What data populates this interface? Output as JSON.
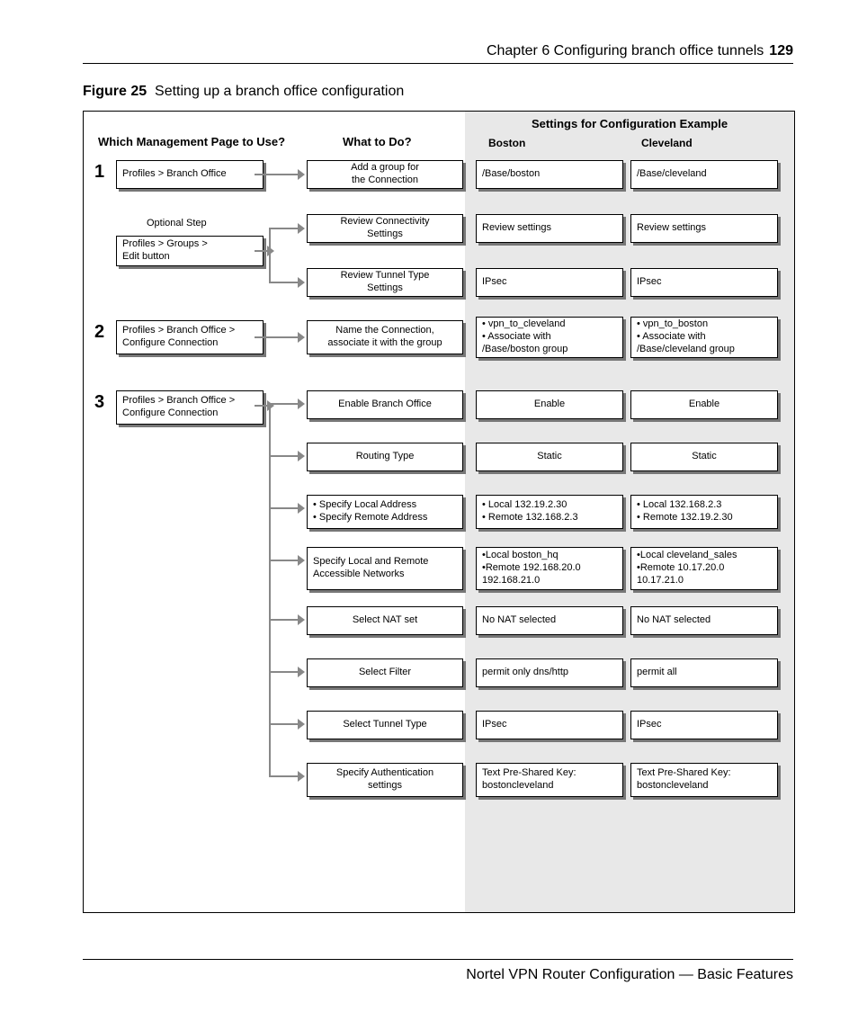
{
  "header": {
    "chapter": "Chapter 6  Configuring branch office tunnels",
    "pageNum": "129"
  },
  "figTitle": {
    "label": "Figure 25",
    "caption": "Setting up a branch office configuration"
  },
  "cols": {
    "mgmt": "Which Management Page to Use?",
    "what": "What to Do?",
    "settings": "Settings for Configuration Example",
    "boston": "Boston",
    "cleveland": "Cleveland"
  },
  "optStep": "Optional Step",
  "step1": {
    "num": "1",
    "page": "Profiles > Branch Office",
    "optPage": "Profiles > Groups >\nEdit button",
    "rows": [
      {
        "what": "Add a group for\nthe Connection",
        "b": "/Base/boston",
        "c": "/Base/cleveland"
      },
      {
        "what": "Review Connectivity\nSettings",
        "b": "Review settings",
        "c": "Review settings"
      },
      {
        "what": "Review Tunnel Type\nSettings",
        "b": "IPsec",
        "c": "IPsec"
      }
    ]
  },
  "step2": {
    "num": "2",
    "page": "Profiles > Branch Office >\nConfigure Connection",
    "rows": [
      {
        "what": "Name the Connection,\nassociate it with the group",
        "b": "• vpn_to_cleveland\n• Associate with\n  /Base/boston group",
        "c": "• vpn_to_boston\n• Associate with\n  /Base/cleveland group"
      }
    ]
  },
  "step3": {
    "num": "3",
    "page": "Profiles > Branch Office >\nConfigure Connection",
    "rows": [
      {
        "what": "Enable Branch Office",
        "b": "Enable",
        "c": "Enable"
      },
      {
        "what": "Routing Type",
        "b": "Static",
        "c": "Static"
      },
      {
        "what": "• Specify Local Address\n• Specify Remote Address",
        "b": "• Local 132.19.2.30\n• Remote 132.168.2.3",
        "c": "• Local 132.168.2.3\n• Remote 132.19.2.30"
      },
      {
        "what": "Specify Local and Remote\nAccessible Networks",
        "b": "•Local boston_hq\n•Remote 192.168.20.0\n            192.168.21.0",
        "c": "•Local cleveland_sales\n•Remote 10.17.20.0\n            10.17.21.0"
      },
      {
        "what": "Select NAT set",
        "b": "No NAT selected",
        "c": "No NAT selected"
      },
      {
        "what": "Select Filter",
        "b": "permit only dns/http",
        "c": "permit all"
      },
      {
        "what": "Select Tunnel Type",
        "b": "IPsec",
        "c": "IPsec"
      },
      {
        "what": "Specify Authentication\nsettings",
        "b": "Text Pre-Shared Key:\nbostoncleveland",
        "c": "Text Pre-Shared Key:\nbostoncleveland"
      }
    ]
  },
  "footer": "Nortel VPN Router Configuration — Basic Features"
}
